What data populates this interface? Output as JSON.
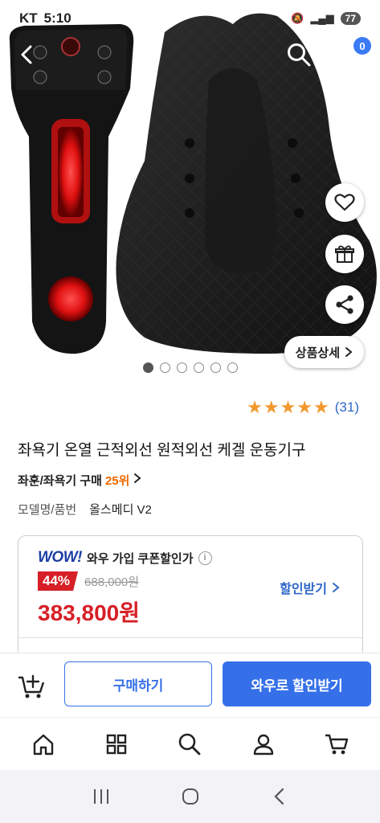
{
  "status_bar": {
    "carrier": "KT",
    "time": "5:10",
    "battery": "77"
  },
  "header": {
    "back_icon": "chevron-left-icon",
    "search_icon": "search-icon",
    "cart_icon": "cart-icon",
    "cart_badge": "0"
  },
  "gallery": {
    "total_images": 6,
    "active_index": 0,
    "detail_button_label": "상품상세",
    "actions": [
      "heart-icon",
      "gift-icon",
      "share-icon"
    ]
  },
  "product": {
    "rating": 5,
    "review_count": "(31)",
    "title": "좌욕기 온열 근적외선 원적외선 케겔 운동기구",
    "rank_category": "좌훈/좌욕기 구매",
    "rank_number": "25위",
    "model_label": "모델명/품번",
    "model_value": "올스메디 V2"
  },
  "price_card": {
    "wow_logo": "WOW!",
    "wow_text": "와우 가입 쿠폰할인가",
    "discount": "44%",
    "original_price": "688,000원",
    "sale_price": "383,800원",
    "coupon_link": "할인받기"
  },
  "purchase_bar": {
    "buy_label": "구매하기",
    "wow_label": "와우로 할인받기"
  },
  "bottom_nav": [
    "home-icon",
    "category-icon",
    "search-icon",
    "my-page-icon",
    "cart-icon"
  ],
  "colors": {
    "accent": "#3670e9",
    "price_red": "#d61f26",
    "rank_orange": "#ee6a00",
    "star": "#f2992e"
  }
}
